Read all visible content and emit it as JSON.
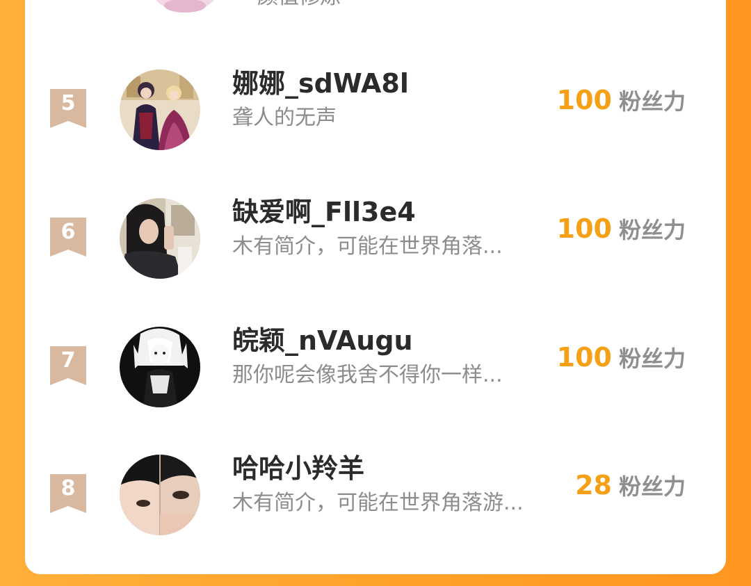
{
  "list": {
    "partial_top": {
      "bio": "颜值修炼"
    },
    "entries": [
      {
        "rank": "5",
        "name": "娜娜_sdWA8l",
        "bio": "聋人的无声",
        "score": "100",
        "unit": "粉丝力",
        "avatar_icon": "avatar-royal-couple"
      },
      {
        "rank": "6",
        "name": "缺爱啊_Fll3e4",
        "bio": "木有简介，可能在世界角落...",
        "score": "100",
        "unit": "粉丝力",
        "avatar_icon": "avatar-girl-mirror-selfie"
      },
      {
        "rank": "7",
        "name": "皖颖_nVAugu",
        "bio": "那你呢会像我舍不得你一样...",
        "score": "100",
        "unit": "粉丝力",
        "avatar_icon": "avatar-anime-girl-bw"
      },
      {
        "rank": "8",
        "name": "哈哈小羚羊",
        "bio": "木有简介，可能在世界角落游...",
        "score": "28",
        "unit": "粉丝力",
        "avatar_icon": "avatar-selfie-collage"
      }
    ]
  },
  "colors": {
    "background_orange": "#ffa22a",
    "score_orange": "#f5a016",
    "rank_badge_tan": "#d8b89f",
    "name_text": "#2b2b2b",
    "bio_text": "#8c8c8c"
  }
}
